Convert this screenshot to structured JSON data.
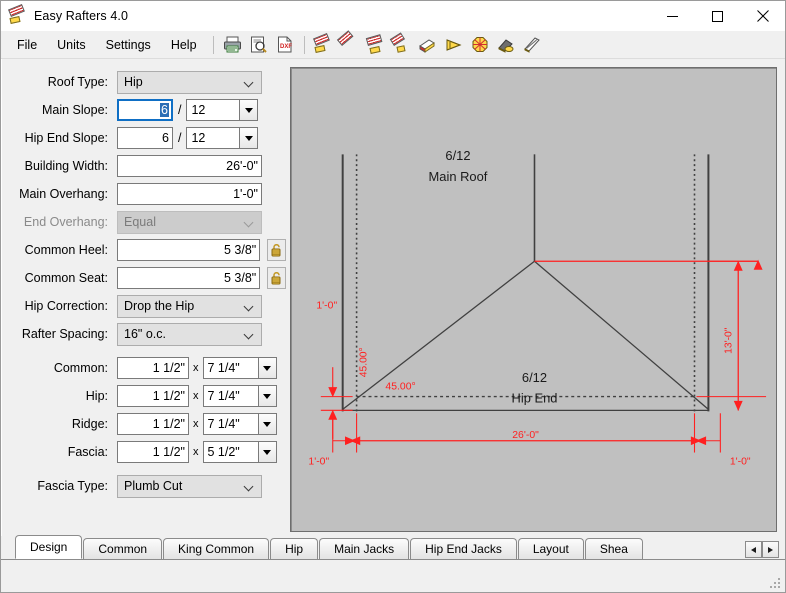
{
  "window": {
    "title": "Easy Rafters 4.0",
    "icon": "rafter-icon",
    "minimize_label": "Minimize",
    "maximize_label": "Maximize",
    "close_label": "Close"
  },
  "menu": {
    "items": [
      "File",
      "Units",
      "Settings",
      "Help"
    ]
  },
  "toolbar": {
    "buttons": [
      {
        "name": "print-icon",
        "label": "Print"
      },
      {
        "name": "print-preview-icon",
        "label": "Print Preview"
      },
      {
        "name": "dxf-export-icon",
        "label": "DXF"
      },
      {
        "name": "common-rafter-icon",
        "label": "Common Rafter"
      },
      {
        "name": "hip-rafter-icon",
        "label": "Hip Rafter"
      },
      {
        "name": "king-common-icon",
        "label": "King Common"
      },
      {
        "name": "jack-rafter-icon",
        "label": "Jack Rafters"
      },
      {
        "name": "sheathing-icon",
        "label": "Sheathing"
      },
      {
        "name": "layout-icon",
        "label": "Layout"
      },
      {
        "name": "octagon-icon",
        "label": "Octagon"
      },
      {
        "name": "valley-icon",
        "label": "Valley"
      },
      {
        "name": "fascia-icon",
        "label": "Fascia"
      }
    ]
  },
  "form": {
    "roof_type": {
      "label": "Roof Type:",
      "value": "Hip"
    },
    "main_slope": {
      "label": "Main Slope:",
      "rise": "6",
      "run": "12",
      "separator": "/"
    },
    "hip_end_slope": {
      "label": "Hip End Slope:",
      "rise": "6",
      "run": "12",
      "separator": "/"
    },
    "building_width": {
      "label": "Building Width:",
      "value": "26'-0\""
    },
    "main_overhang": {
      "label": "Main Overhang:",
      "value": "1'-0\""
    },
    "end_overhang": {
      "label": "End Overhang:",
      "value": "Equal",
      "disabled": true
    },
    "common_heel": {
      "label": "Common Heel:",
      "value": "5 3/8\"",
      "lock": "unlocked-padlock-icon"
    },
    "common_seat": {
      "label": "Common Seat:",
      "value": "5 3/8\"",
      "lock": "unlocked-padlock-icon"
    },
    "hip_correction": {
      "label": "Hip Correction:",
      "value": "Drop the Hip"
    },
    "rafter_spacing": {
      "label": "Rafter Spacing:",
      "value": "16\" o.c."
    },
    "lumber_separator": "x",
    "common": {
      "label": "Common:",
      "thickness": "1 1/2\"",
      "depth": "7 1/4\""
    },
    "hip": {
      "label": "Hip:",
      "thickness": "1 1/2\"",
      "depth": "7 1/4\""
    },
    "ridge": {
      "label": "Ridge:",
      "thickness": "1 1/2\"",
      "depth": "7 1/4\""
    },
    "fascia": {
      "label": "Fascia:",
      "thickness": "1 1/2\"",
      "depth": "5 1/2\""
    },
    "fascia_type": {
      "label": "Fascia Type:",
      "value": "Plumb Cut"
    }
  },
  "drawing": {
    "main_roof_slope": "6/12",
    "main_roof_label": "Main Roof",
    "hip_end_slope": "6/12",
    "hip_end_label": "Hip End",
    "height_dim": "13'-0\"",
    "width_dim": "26'-0\"",
    "left_overhang_dim": "1'-0\"",
    "bottom_left_overhang_dim": "1'-0\"",
    "bottom_right_overhang_dim": "1'-0\"",
    "hip_angle_plan": "45.00°",
    "hip_angle_vert": "45.00°",
    "dim_color": "#ff2020",
    "line_color": "#404040",
    "background": "#c0c0c0"
  },
  "tabs": {
    "items": [
      {
        "label": "Design",
        "active": true
      },
      {
        "label": "Common",
        "active": false
      },
      {
        "label": "King Common",
        "active": false
      },
      {
        "label": "Hip",
        "active": false
      },
      {
        "label": "Main Jacks",
        "active": false
      },
      {
        "label": "Hip End Jacks",
        "active": false
      },
      {
        "label": "Layout",
        "active": false
      },
      {
        "label": "Shea",
        "active": false
      }
    ],
    "scroll_left": "◀",
    "scroll_right": "▶"
  }
}
